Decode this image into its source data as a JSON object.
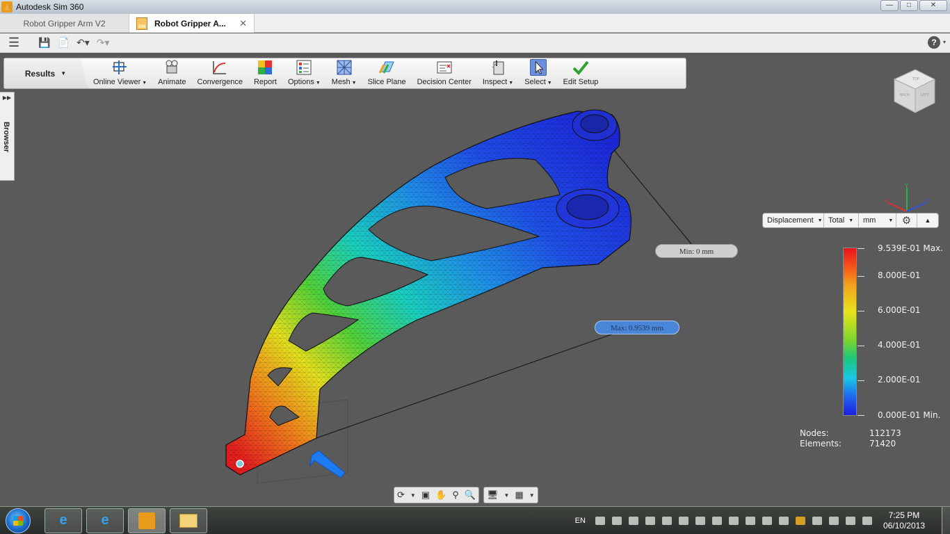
{
  "window": {
    "title": "Autodesk Sim 360"
  },
  "tabs": [
    {
      "label": "Robot Gripper Arm V2",
      "active": false
    },
    {
      "label": "Robot Gripper A...",
      "active": true
    }
  ],
  "ribbon": {
    "tab_label": "Results",
    "tools": [
      {
        "label": "Online Viewer",
        "dropdown": true,
        "icon": "online-viewer-icon"
      },
      {
        "label": "Animate",
        "dropdown": false,
        "icon": "animate-icon"
      },
      {
        "label": "Convergence",
        "dropdown": false,
        "icon": "convergence-icon"
      },
      {
        "label": "Report",
        "dropdown": false,
        "icon": "report-icon"
      },
      {
        "label": "Options",
        "dropdown": true,
        "icon": "options-icon"
      },
      {
        "label": "Mesh",
        "dropdown": true,
        "icon": "mesh-icon"
      },
      {
        "label": "Slice Plane",
        "dropdown": false,
        "icon": "slice-plane-icon"
      },
      {
        "label": "Decision Center",
        "dropdown": false,
        "icon": "decision-center-icon"
      },
      {
        "label": "Inspect",
        "dropdown": true,
        "icon": "inspect-icon"
      },
      {
        "label": "Select",
        "dropdown": true,
        "icon": "select-cursor-icon",
        "selected": true
      },
      {
        "label": "Edit Setup",
        "dropdown": false,
        "icon": "checkmark-icon"
      }
    ]
  },
  "browser": {
    "label": "Browser"
  },
  "results": {
    "result_type": "Displacement",
    "component": "Total",
    "unit": "mm"
  },
  "legend": {
    "max_label": "9.539E-01 Max.",
    "ticks": [
      "8.000E-01",
      "6.000E-01",
      "4.000E-01",
      "2.000E-01"
    ],
    "min_label": "0.000E-01 Min."
  },
  "stats": {
    "nodes_label": "Nodes:",
    "nodes_value": "112173",
    "elements_label": "Elements:",
    "elements_value": "71420"
  },
  "callouts": {
    "min": "Min: 0 mm",
    "max": "Max: 0.9539 mm"
  },
  "viewcube": {
    "faces": [
      "TOP",
      "BACK",
      "LEFT"
    ]
  },
  "taskbar": {
    "language": "EN",
    "time": "7:25 PM",
    "date": "06/10/2013"
  }
}
